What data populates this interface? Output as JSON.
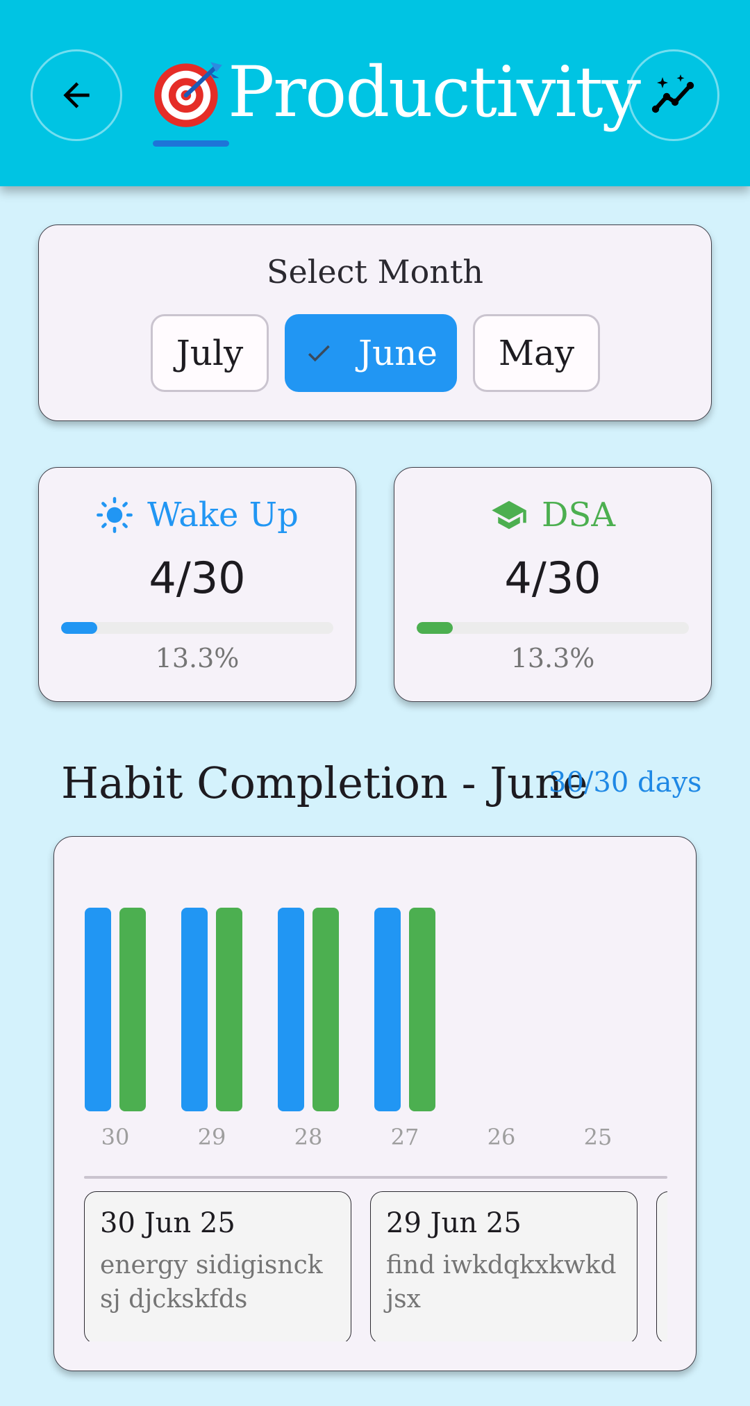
{
  "header": {
    "title": "Productivity",
    "title_emoji": "target-dart-icon",
    "back_icon": "arrow-back-icon",
    "insights_icon": "sparkle-trend-icon",
    "background_color": "#00c4e3"
  },
  "month_selector": {
    "title": "Select Month",
    "options": [
      {
        "label": "July",
        "selected": false
      },
      {
        "label": "June",
        "selected": true
      },
      {
        "label": "May",
        "selected": false
      }
    ],
    "selected_color": "#2196f3"
  },
  "stats": [
    {
      "label": "Wake Up",
      "icon": "sun-icon",
      "value": "4/30",
      "percent_text": "13.3%",
      "progress": 0.133,
      "color": "#2196f3"
    },
    {
      "label": "DSA",
      "icon": "graduation-cap-icon",
      "value": "4/30",
      "percent_text": "13.3%",
      "progress": 0.133,
      "color": "#4caf50"
    }
  ],
  "completion": {
    "title": "Habit Completion - June",
    "days_text": "30/30 days"
  },
  "chart_data": {
    "type": "bar",
    "categories": [
      "30",
      "29",
      "28",
      "27",
      "26",
      "25"
    ],
    "series": [
      {
        "values": [
          1,
          1,
          1,
          1,
          0,
          0
        ],
        "color": "#2196f3"
      },
      {
        "values": [
          1,
          1,
          1,
          1,
          0,
          0
        ],
        "color": "#4caf50"
      }
    ],
    "ylim": [
      0,
      1
    ]
  },
  "notes": [
    {
      "date": "30 Jun 25",
      "text": "energy sidigisncksj djckskfds"
    },
    {
      "date": "29 Jun 25",
      "text": "find iwkdqkxkwkdjsx"
    }
  ]
}
